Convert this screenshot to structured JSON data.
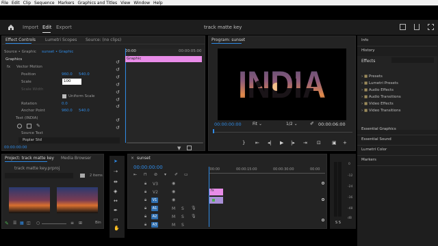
{
  "menubar": {
    "items": [
      "File",
      "Edit",
      "Clip",
      "Sequence",
      "Markers",
      "Graphics and Titles",
      "View",
      "Window",
      "Help"
    ]
  },
  "topbar": {
    "tabs": [
      "Import",
      "Edit",
      "Export"
    ],
    "active_tab": "Edit",
    "project_title": "track matte key"
  },
  "effect_controls": {
    "tabs": [
      "Effect Controls",
      "Lumetri Scopes",
      "Source: (no clips)"
    ],
    "source_label": "Source • Graphic",
    "sequence_label": "sunset • Graphic",
    "timecode_start": "00:00",
    "timecode_end": "00:00:05:00",
    "clip_name": "Graphic",
    "section": "Graphics",
    "vector_motion": "Vector Motion",
    "params": [
      {
        "name": "Position",
        "v1": "960.0",
        "v2": "540.0"
      },
      {
        "name": "Scale",
        "v1": "100",
        "v2": ""
      },
      {
        "name": "Scale Width",
        "v1": "",
        "v2": ""
      },
      {
        "name": "Uniform Scale",
        "v1": "",
        "v2": ""
      },
      {
        "name": "Rotation",
        "v1": "0.0",
        "v2": ""
      },
      {
        "name": "Anchor Point",
        "v1": "960.0",
        "v2": "540.0"
      }
    ],
    "text_layer": "Text (INDIA)",
    "source_text": "Source Text",
    "font": "Poplar Std",
    "bottom_time": "00:00:00:00"
  },
  "program": {
    "title": "Program: sunset",
    "overlay_text": "INDIA",
    "timecode_current": "00:00:00:00",
    "fit": "Fit",
    "resolution": "1/2",
    "timecode_total": "00:00:06:00"
  },
  "right_panel": {
    "items_top": [
      "Info",
      "History"
    ],
    "effects_title": "Effects",
    "effects_folders": [
      "Presets",
      "Lumetri Presets",
      "Audio Effects",
      "Audio Transitions",
      "Video Effects",
      "Video Transitions"
    ],
    "items_bottom": [
      "Essential Graphics",
      "Essential Sound",
      "Lumetri Color",
      "Markers"
    ]
  },
  "project": {
    "tabs": [
      "Project: track matte key",
      "Media Browser"
    ],
    "file": "track matte key.prproj",
    "count": "2 items",
    "bin_label": "Bin"
  },
  "timeline": {
    "title": "sunset",
    "timecode": "00:00:00:00",
    "ruler": [
      ":00:00",
      "00:00:15:00",
      "00:00:30:00",
      "00:00"
    ],
    "tracks": [
      "V3",
      "V2",
      "V1",
      "A1",
      "A2",
      "A3"
    ],
    "clip_v2_label": "fx"
  },
  "audio_meter": {
    "labels": [
      "0",
      "-12",
      "-24",
      "-36",
      "-48",
      "dB"
    ],
    "channels": "S S"
  },
  "colors": {
    "accent": "#2f8ce8",
    "clip_pink": "#e88ce8",
    "clip_green_bg": "#a98fd6"
  }
}
